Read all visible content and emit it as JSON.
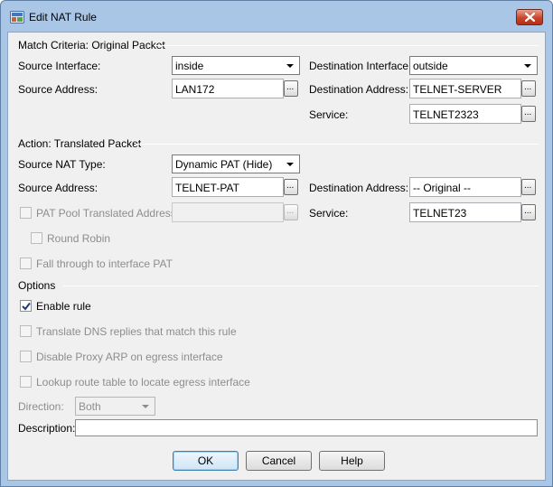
{
  "window": {
    "title": "Edit NAT Rule"
  },
  "match": {
    "section": "Match Criteria: Original Packet",
    "source_interface_label": "Source Interface:",
    "source_interface": "inside",
    "destination_interface_label": "Destination Interface:",
    "destination_interface": "outside",
    "source_address_label": "Source Address:",
    "source_address": "LAN172",
    "destination_address_label": "Destination Address:",
    "destination_address": "TELNET-SERVER",
    "service_label": "Service:",
    "service": "TELNET2323"
  },
  "action": {
    "section": "Action: Translated Packet",
    "source_nat_type_label": "Source NAT Type:",
    "source_nat_type": "Dynamic PAT (Hide)",
    "source_address_label": "Source Address:",
    "source_address": "TELNET-PAT",
    "destination_address_label": "Destination Address:",
    "destination_address": "-- Original --",
    "pat_pool_label": "PAT Pool Translated Address:",
    "pat_pool_value": "",
    "service_label": "Service:",
    "service": "TELNET23",
    "round_robin_label": "Round Robin",
    "fall_through_label": "Fall through to interface PAT"
  },
  "options": {
    "section": "Options",
    "enable_rule_label": "Enable rule",
    "enable_rule_checked": true,
    "translate_dns_label": "Translate DNS replies that match this rule",
    "disable_proxy_arp_label": "Disable Proxy ARP on egress interface",
    "lookup_route_label": "Lookup route table to locate egress interface",
    "direction_label": "Direction:",
    "direction": "Both",
    "description_label": "Description:",
    "description": ""
  },
  "buttons": {
    "ok": "OK",
    "cancel": "Cancel",
    "help": "Help",
    "browse": "..."
  },
  "colors": {
    "title_bar": "#a9c6e6",
    "close_button": "#c9452b",
    "default_button_border": "#3c7fb1"
  }
}
